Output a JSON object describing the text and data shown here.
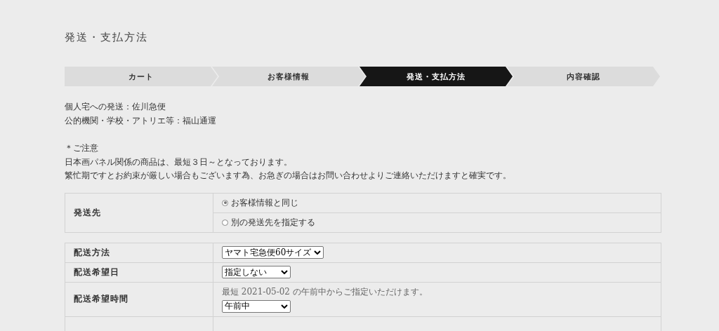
{
  "page_title": "発送・支払方法",
  "steps": [
    {
      "label": "カート",
      "selected": false
    },
    {
      "label": "お客様情報",
      "selected": false
    },
    {
      "label": "発送・支払方法",
      "selected": true
    },
    {
      "label": "内容確認",
      "selected": false
    }
  ],
  "carriers": [
    "個人宅への発送：佐川急便",
    "公的機関・学校・アトリエ等：福山通運"
  ],
  "notice": {
    "heading": "＊ご注意",
    "lines": [
      "日本画パネル関係の商品は、最短３日～となっております。",
      "繁忙期ですとお約束が厳しい場合もございます為、お急ぎの場合はお問い合わせよりご連絡いただけますと確実です。"
    ]
  },
  "destination": {
    "label": "発送先",
    "options": [
      {
        "label": "お客様情報と同じ",
        "checked": true
      },
      {
        "label": "別の発送先を指定する",
        "checked": false
      }
    ]
  },
  "delivery_rows": [
    {
      "label": "配送方法",
      "value": "ヤマト宅急便60サイズ"
    },
    {
      "label": "配送希望日",
      "value": "指定しない"
    },
    {
      "label": "配送希望時間",
      "note": "最短 2021-05-02 の午前中からご指定いただけます。",
      "value": "午前中"
    }
  ]
}
